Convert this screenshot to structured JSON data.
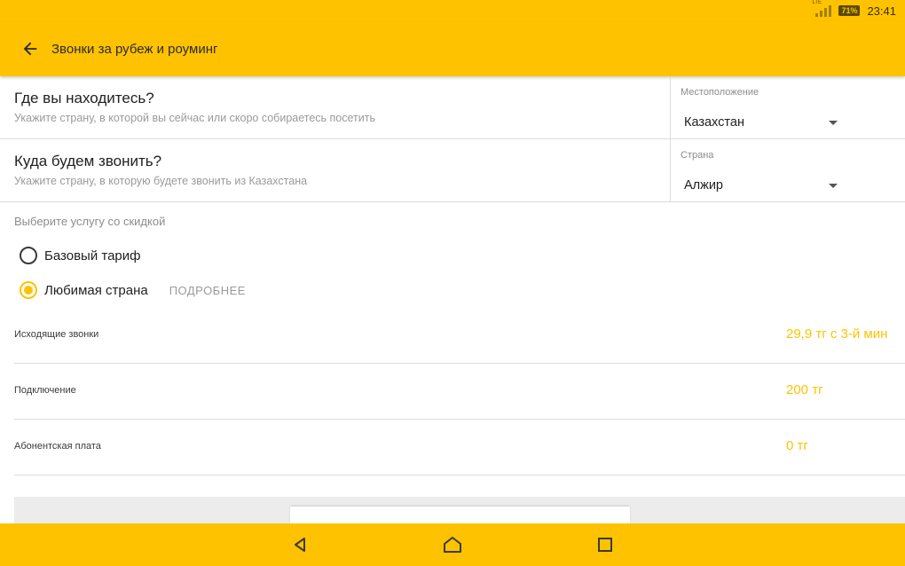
{
  "status_bar": {
    "network": "LTE",
    "battery": "71%",
    "time": "23:41"
  },
  "app_bar": {
    "back_icon": "arrow-left-icon",
    "title": "Звонки за рубеж и роуминг"
  },
  "location_row": {
    "question": "Где вы находитесь?",
    "hint": "Укажите страну, в которой вы сейчас или скоро собираетесь посетить",
    "picker_label": "Местоположение",
    "picker_value": "Казахстан"
  },
  "destination_row": {
    "question": "Куда будем звонить?",
    "hint": "Укажите страну, в которую будете звонить из Казахстана",
    "picker_label": "Страна",
    "picker_value": "Алжир"
  },
  "service": {
    "label": "Выберите услугу со скидкой",
    "options": [
      {
        "label": "Базовый тариф",
        "selected": false
      },
      {
        "label": "Любимая страна",
        "selected": true,
        "more": "ПОДРОБНЕЕ"
      }
    ]
  },
  "prices": [
    {
      "name": "Исходящие звонки",
      "value": "29,9 тг с 3-й мин"
    },
    {
      "name": "Подключение",
      "value": "200 тг"
    },
    {
      "name": "Абонентская плата",
      "value": "0 тг"
    }
  ],
  "nav_bar": {
    "icons": [
      "nav-back-icon",
      "nav-home-icon",
      "nav-recent-icon"
    ]
  },
  "colors": {
    "accent": "#ffc200",
    "text_primary": "#212121",
    "text_secondary": "#9a9a9a",
    "divider": "#dcdcdc"
  }
}
